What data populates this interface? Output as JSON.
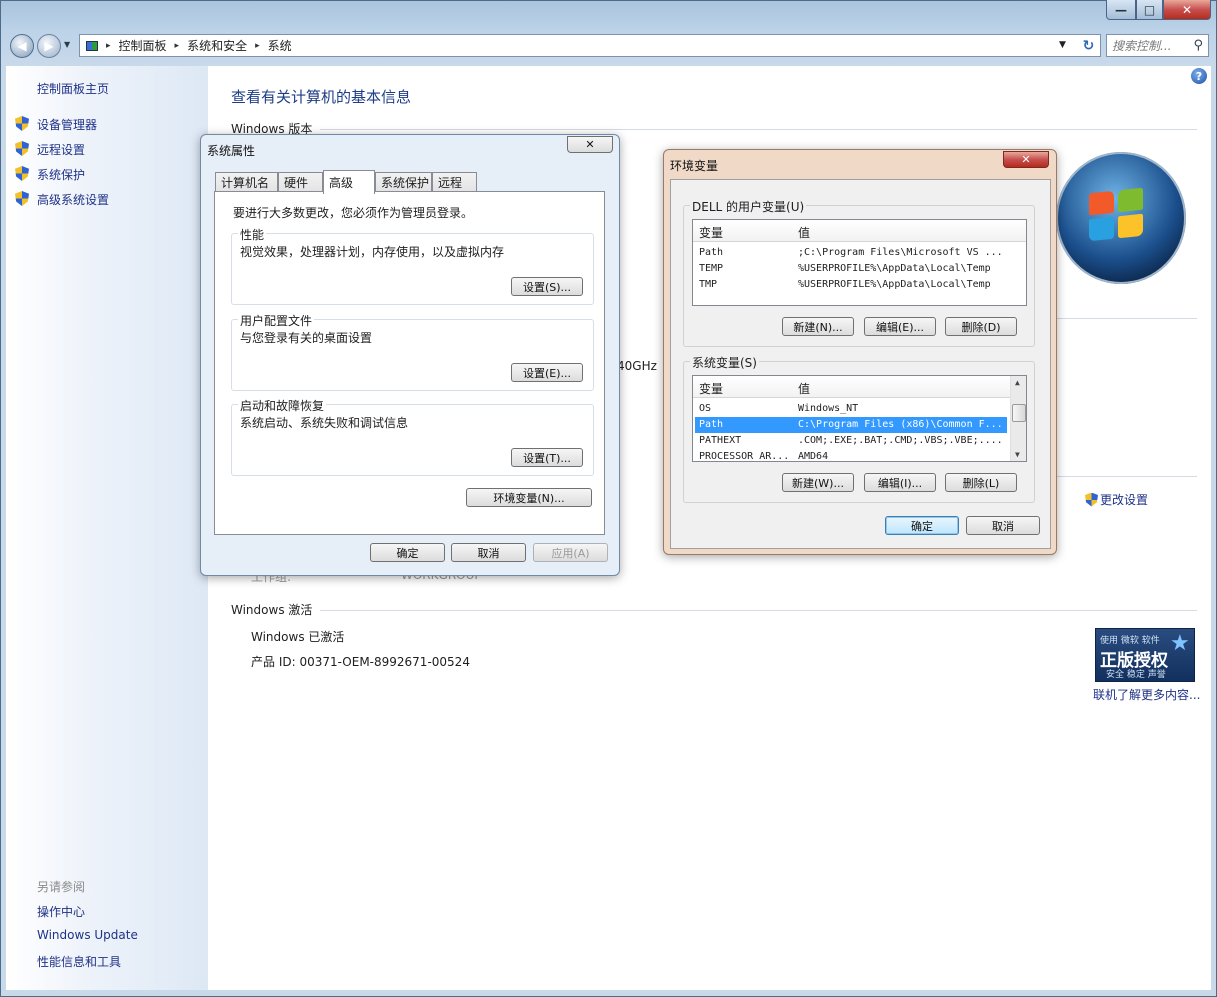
{
  "address": {
    "crumbs": [
      "控制面板",
      "系统和安全",
      "系统"
    ],
    "search_placeholder": "搜索控制...",
    "sep": "▸"
  },
  "caption": {
    "min": "—",
    "max": "□",
    "close": "✕"
  },
  "icons": {
    "back": "◀",
    "forward": "▶",
    "history": "▼",
    "drop": "▼",
    "refresh": "↻",
    "search": "⚲",
    "help": "?",
    "close": "✕",
    "scroll_up": "▲",
    "scroll_down": "▼",
    "star": "★"
  },
  "left_pane": {
    "home": "控制面板主页",
    "items": [
      "设备管理器",
      "远程设置",
      "系统保护",
      "高级系统设置"
    ],
    "see_also_title": "另请参阅",
    "see_also": [
      "操作中心",
      "Windows Update",
      "性能信息和工具"
    ]
  },
  "main": {
    "title": "查看有关计算机的基本信息",
    "edition_heading": "Windows 版本",
    "cpu_fragment": "40GHz",
    "change_settings": "更改设置",
    "workgroup_label": "工作组:",
    "workgroup_value": "WORKGROUP",
    "activation_heading": "Windows 激活",
    "activated": "Windows 已激活",
    "product_id": "产品 ID: 00371-OEM-8992671-00524",
    "genuine": {
      "top": "使用 微软 软件",
      "main": "正版授权",
      "sub": "安全 稳定 声誉"
    },
    "learn_more": "联机了解更多内容..."
  },
  "sys_props": {
    "title": "系统属性",
    "tabs": [
      "计算机名",
      "硬件",
      "高级",
      "系统保护",
      "远程"
    ],
    "active_tab": "高级",
    "admin_note": "要进行大多数更改，您必须作为管理员登录。",
    "perf_label": "性能",
    "perf_desc": "视觉效果，处理器计划，内存使用，以及虚拟内存",
    "perf_btn": "设置(S)...",
    "profile_label": "用户配置文件",
    "profile_desc": "与您登录有关的桌面设置",
    "profile_btn": "设置(E)...",
    "startup_label": "启动和故障恢复",
    "startup_desc": "系统启动、系统失败和调试信息",
    "startup_btn": "设置(T)...",
    "env_btn": "环境变量(N)...",
    "ok": "确定",
    "cancel": "取消",
    "apply": "应用(A)"
  },
  "env_vars": {
    "title": "环境变量",
    "user_group": "DELL 的用户变量(U)",
    "col_var": "变量",
    "col_val": "值",
    "user_rows": [
      {
        "name": "Path",
        "value": ";C:\\Program Files\\Microsoft VS ..."
      },
      {
        "name": "TEMP",
        "value": "%USERPROFILE%\\AppData\\Local\\Temp"
      },
      {
        "name": "TMP",
        "value": "%USERPROFILE%\\AppData\\Local\\Temp"
      }
    ],
    "user_new": "新建(N)...",
    "user_edit": "编辑(E)...",
    "user_delete": "删除(D)",
    "sys_group": "系统变量(S)",
    "sys_rows": [
      {
        "name": "OS",
        "value": "Windows_NT"
      },
      {
        "name": "Path",
        "value": "C:\\Program Files (x86)\\Common F..."
      },
      {
        "name": "PATHEXT",
        "value": ".COM;.EXE;.BAT;.CMD;.VBS;.VBE;...."
      },
      {
        "name": "PROCESSOR_AR...",
        "value": "AMD64"
      }
    ],
    "sys_selected_index": 1,
    "sys_new": "新建(W)...",
    "sys_edit": "编辑(I)...",
    "sys_delete": "删除(L)",
    "ok": "确定",
    "cancel": "取消"
  },
  "colors": {
    "link": "#1e3287",
    "title": "#1e3d87",
    "selection": "#3399ff"
  }
}
